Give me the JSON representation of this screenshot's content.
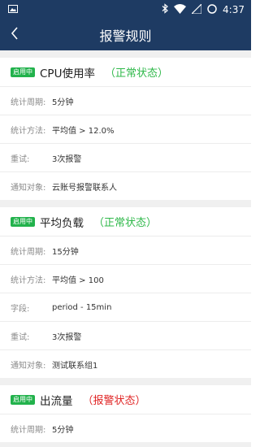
{
  "status_bar": {
    "time": "4:37",
    "icons": [
      "image-notification-icon",
      "bluetooth-icon",
      "wifi-icon",
      "signal-icon",
      "battery-icon"
    ]
  },
  "app_bar": {
    "back_icon": "chevron-left-icon",
    "title": "报警规则"
  },
  "rules": [
    {
      "badge": "启用中",
      "name": "CPU使用率",
      "status": "（正常状态）",
      "status_type": "normal",
      "fields": [
        {
          "label": "统计周期:",
          "value": "5分钟"
        },
        {
          "label": "统计方法:",
          "value": "平均值 > 12.0%"
        },
        {
          "label": "重试:",
          "value": "3次报警"
        },
        {
          "label": "通知对象:",
          "value": "云账号报警联系人"
        }
      ]
    },
    {
      "badge": "启用中",
      "name": "平均负载",
      "status": "（正常状态）",
      "status_type": "normal",
      "fields": [
        {
          "label": "统计周期:",
          "value": "15分钟"
        },
        {
          "label": "统计方法:",
          "value": "平均值 > 100"
        },
        {
          "label": "字段:",
          "value": "period - 15min"
        },
        {
          "label": "重试:",
          "value": "3次报警"
        },
        {
          "label": "通知对象:",
          "value": "测试联系组1"
        }
      ]
    },
    {
      "badge": "启用中",
      "name": "出流量",
      "status": "（报警状态）",
      "status_type": "alarm",
      "fields": [
        {
          "label": "统计周期:",
          "value": "5分钟"
        }
      ]
    }
  ],
  "colors": {
    "header": "#1e3b63",
    "badge": "#22b24c",
    "normal": "#2fb84a",
    "alarm": "#e02525"
  }
}
